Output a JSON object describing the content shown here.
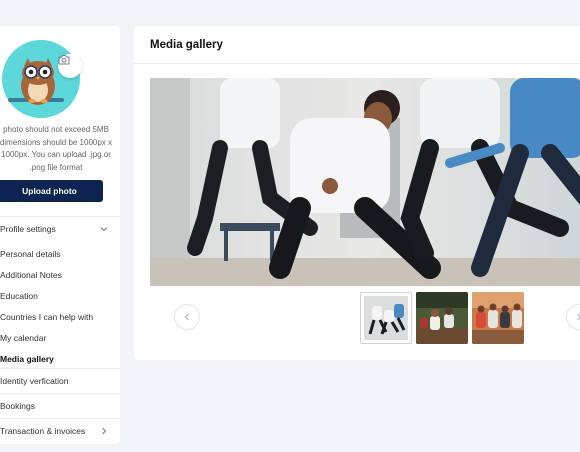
{
  "sidebar": {
    "photo_note": "photo should not exceed 5MB dimensions should be 1000px x 1000px. You can upload .jpg or .png file format",
    "upload_label": "Upload photo",
    "profile_settings": {
      "label": "Profile settings",
      "items": [
        {
          "label": "Personal details"
        },
        {
          "label": "Additional Notes"
        },
        {
          "label": "Education"
        },
        {
          "label": "Countries I can help with"
        },
        {
          "label": "My calendar"
        },
        {
          "label": "Media gallery",
          "active": true
        }
      ]
    },
    "identity_verification": "Identity verfication",
    "bookings": "Bookings",
    "transactions": "Transaction & invoices"
  },
  "main": {
    "title": "Media gallery"
  },
  "colors": {
    "avatar_bg": "#5dd8da",
    "primary_button": "#0d2451",
    "page_bg": "#f3f4f7"
  },
  "icons": [
    "camera-icon",
    "chevron-down-icon",
    "chevron-right-icon",
    "chevron-left-icon"
  ]
}
